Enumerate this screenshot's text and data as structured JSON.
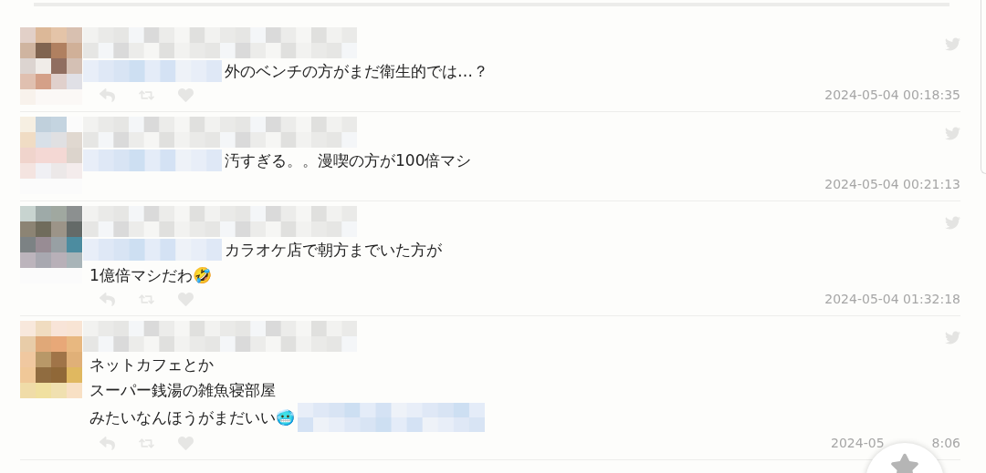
{
  "tweets": [
    {
      "lines": [
        "外のベンチの方がまだ衛生的では…？"
      ],
      "redacted_before": true,
      "redacted_after": false,
      "actions_visible": true,
      "timestamp": [
        "2024-05-04 00:18:35"
      ]
    },
    {
      "lines": [
        "汚すぎる。。漫喫の方が100倍マシ"
      ],
      "redacted_before": true,
      "redacted_after": false,
      "actions_visible": false,
      "timestamp": [
        "2024-05-04 00:21:13"
      ]
    },
    {
      "lines": [
        "カラオケ店で朝方までいた方が",
        "1億倍マシだわ🤣"
      ],
      "redacted_before": true,
      "redacted_after": false,
      "actions_visible": true,
      "timestamp": [
        "2024-05-04 01:32:18"
      ]
    },
    {
      "lines": [
        "ネットカフェとか",
        "スーパー銭湯の雑魚寝部屋",
        "みたいなんほうがまだいい🥶"
      ],
      "redacted_before": false,
      "redacted_after": true,
      "actions_visible": true,
      "timestamp": [
        "2024-05",
        "8:06"
      ]
    }
  ]
}
